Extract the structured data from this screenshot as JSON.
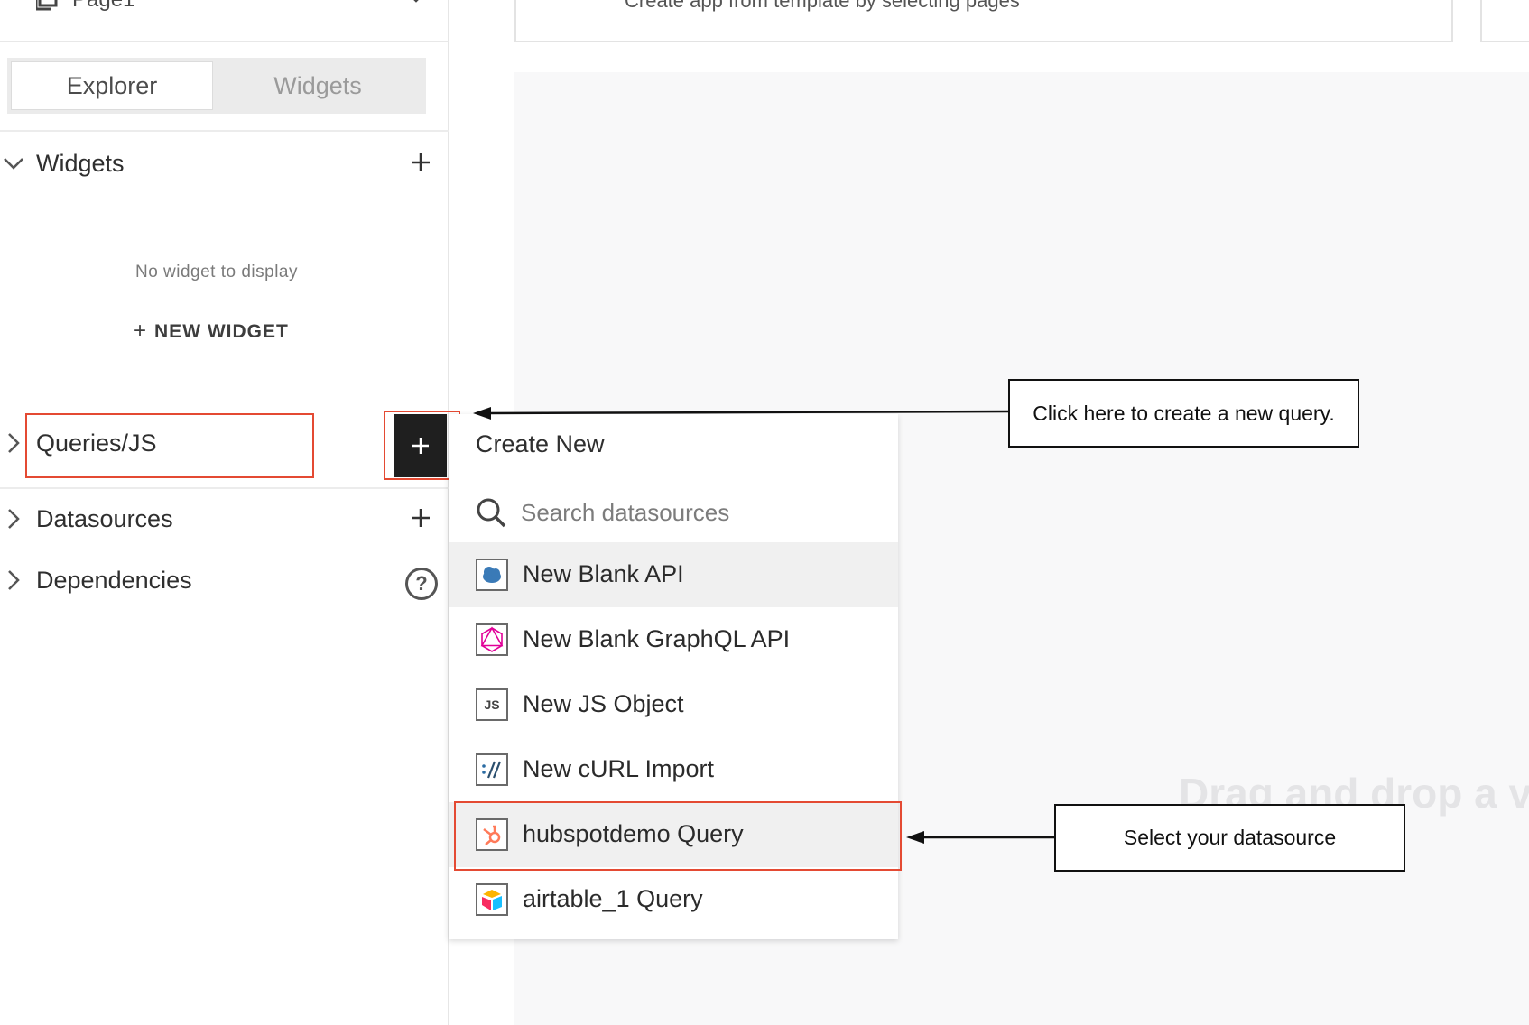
{
  "header": {
    "page_name": "Page1",
    "template_text": "Create app from template by selecting pages"
  },
  "sidebar": {
    "tabs": [
      {
        "label": "Explorer",
        "active": true
      },
      {
        "label": "Widgets",
        "active": false
      }
    ],
    "widgets_section": {
      "title": "Widgets",
      "empty_text": "No widget to display",
      "new_widget_label": "NEW WIDGET"
    },
    "queries_section": {
      "title": "Queries/JS"
    },
    "datasources_section": {
      "title": "Datasources"
    },
    "dependencies_section": {
      "title": "Dependencies"
    },
    "help_glyph": "?"
  },
  "canvas": {
    "drag_text": "Drag and drop a v"
  },
  "dropdown": {
    "header": "Create New",
    "search_placeholder": "Search datasources",
    "items": [
      {
        "label": "New Blank API",
        "icon": "cloud-icon"
      },
      {
        "label": "New Blank GraphQL API",
        "icon": "graphql-icon"
      },
      {
        "label": "New JS Object",
        "icon": "js-icon"
      },
      {
        "label": "New cURL Import",
        "icon": "curl-icon"
      },
      {
        "label": "hubspotdemo Query",
        "icon": "hubspot-icon"
      },
      {
        "label": "airtable_1 Query",
        "icon": "airtable-icon"
      }
    ],
    "js_icon_text": "JS"
  },
  "annotations": {
    "create_query": "Click here to create a new query.",
    "select_datasource": "Select your datasource"
  },
  "colors": {
    "highlight": "#e44a33",
    "dark_button": "#1f1f1f",
    "hover_row": "#f0f0f0"
  }
}
